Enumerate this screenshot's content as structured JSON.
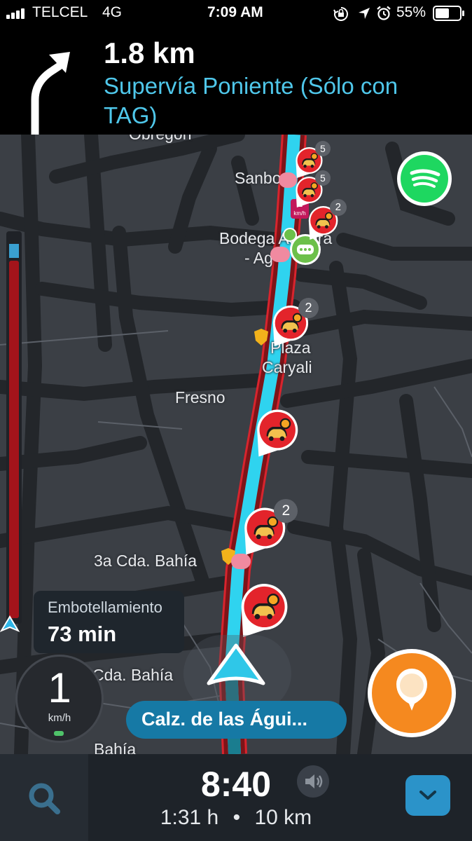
{
  "status_bar": {
    "carrier": "TELCEL",
    "network": "4G",
    "time": "7:09 AM",
    "battery": "55%",
    "icons": [
      "signal-icon",
      "rotation-lock-icon",
      "location-arrow-icon",
      "alarm-icon",
      "battery-icon"
    ]
  },
  "navigation": {
    "turn_icon": "turn-right-arrow-icon",
    "distance": "1.8 km",
    "street": "Supervía Poniente (Sólo con TAG)"
  },
  "map": {
    "labels": [
      "Obregón",
      "Sanbo",
      "Bodega Aurrera",
      "- Ag",
      "Plaza",
      "Caryali",
      "Fresno",
      "3a Cda. Bahía",
      "1a Cda. Bahía",
      "Bahía"
    ],
    "speed_camera_label": "2",
    "speed_camera_unit": "km/h",
    "traffic_alerts": [
      {
        "count": "5"
      },
      {
        "count": "5"
      },
      {
        "count": "2"
      },
      {
        "count": "2"
      },
      {
        "count": ""
      },
      {
        "count": "2"
      },
      {
        "count": ""
      }
    ],
    "colors": {
      "route": "#2fd3ef",
      "traffic": "#e8262f",
      "accent": "#f5891f"
    }
  },
  "traffic_card": {
    "label": "Embotellamiento",
    "value": "73 min"
  },
  "speedometer": {
    "value": "1",
    "unit": "km/h"
  },
  "current_street": "Calz. de las Águi...",
  "bottom_bar": {
    "eta_time": "8:40",
    "duration": "1:31 h",
    "separator": "•",
    "distance": "10 km"
  }
}
